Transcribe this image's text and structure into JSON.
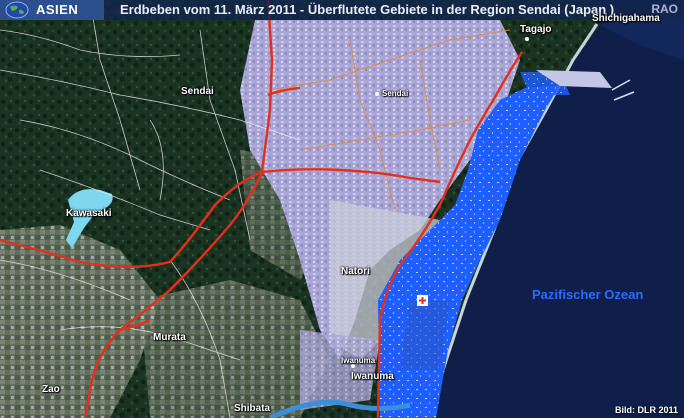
{
  "header": {
    "region": "ASIEN",
    "title": "Erdbeben vom 11. März 2011 - Überflutete Gebiete in der Region Sendai (Japan )",
    "agency": "RAO"
  },
  "places": {
    "tagajo": "Tagajo",
    "shichigahama": "Shichigahama",
    "sendai_region": "Sendai",
    "sendai_city": "Sendai",
    "kawasaki": "Kawasaki",
    "natori": "Natori",
    "murata": "Murata",
    "iwanuma_small": "Iwanuma",
    "iwanuma": "Iwanuma",
    "zao": "Zao",
    "shibata": "Shibata"
  },
  "ocean_label": "Pazifischer Ozean",
  "credit": "Bild: DLR 2011",
  "icons": {
    "globe": "globe-icon",
    "airport": "airport-icon"
  },
  "colors": {
    "flooded_area": "#1f5fff",
    "ocean": "#10204a",
    "urban": "#a8a4d8",
    "forest": "#1a3020",
    "roads": "#e0301c",
    "lake": "#7fd6ef"
  }
}
